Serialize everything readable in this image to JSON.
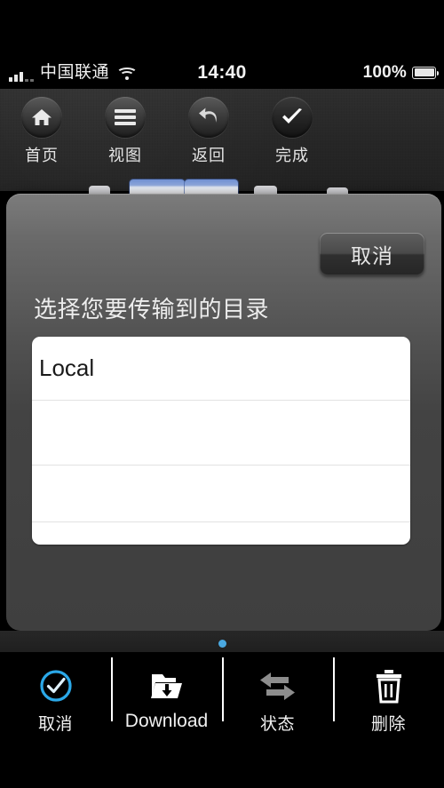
{
  "status_bar": {
    "carrier": "中国联通",
    "time": "14:40",
    "battery_percent": "100%",
    "signal_icon": "signal-bars-icon",
    "wifi_icon": "wifi-icon",
    "battery_icon": "battery-full-icon"
  },
  "toolbar": {
    "items": [
      {
        "label": "首页",
        "icon": "home-icon"
      },
      {
        "label": "视图",
        "icon": "list-view-icon"
      },
      {
        "label": "返回",
        "icon": "undo-back-arrow-icon"
      },
      {
        "label": "完成",
        "icon": "checkmark-icon"
      }
    ]
  },
  "popover": {
    "cancel_label": "取消",
    "title": "选择您要传输到的目录",
    "rows": [
      {
        "label": "Local"
      },
      {
        "label": ""
      },
      {
        "label": ""
      },
      {
        "label": ""
      }
    ]
  },
  "pager": {
    "dot_color": "#4aa8e0",
    "dot_count": 1,
    "active_index": 0
  },
  "tabbar": {
    "items": [
      {
        "label": "取消",
        "icon": "check-circle-icon",
        "color": "#2ba8e8",
        "script": "cjk"
      },
      {
        "label": "Download",
        "icon": "folder-download-icon",
        "color": "#ffffff",
        "script": "latin"
      },
      {
        "label": "状态",
        "icon": "transfer-arrows-icon",
        "color": "#8a8a8a",
        "script": "cjk"
      },
      {
        "label": "删除",
        "icon": "trash-icon",
        "color": "#ffffff",
        "script": "cjk"
      }
    ]
  }
}
